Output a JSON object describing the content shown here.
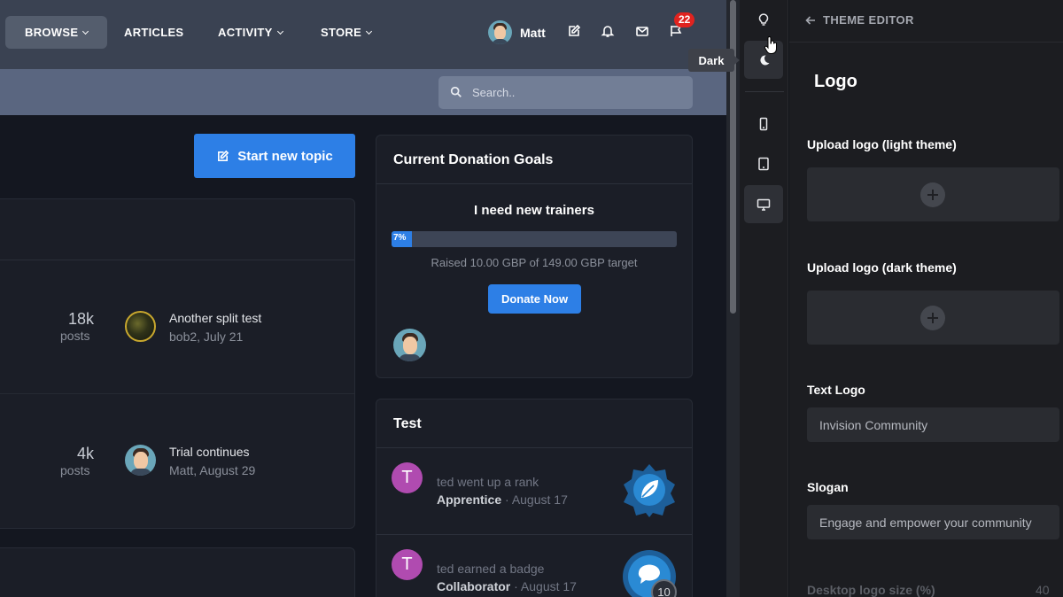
{
  "nav": {
    "items": [
      {
        "label": "BROWSE",
        "dropdown": true
      },
      {
        "label": "ARTICLES",
        "dropdown": false
      },
      {
        "label": "ACTIVITY",
        "dropdown": true
      },
      {
        "label": "STORE",
        "dropdown": true
      }
    ],
    "user_name": "Matt",
    "notification_count": "22",
    "icons": [
      "edit-icon",
      "bell-icon",
      "mail-icon",
      "flag-icon"
    ]
  },
  "search": {
    "placeholder": "Search.."
  },
  "main": {
    "start_topic_label": "Start new topic",
    "forums": [
      {
        "count": "18k",
        "count_label": "posts",
        "last_title": "Another split test",
        "last_meta": "bob2, July 21"
      },
      {
        "count": "4k",
        "count_label": "posts",
        "last_title": "Trial continues",
        "last_meta": "Matt, August 29"
      }
    ]
  },
  "donation": {
    "title": "Current Donation Goals",
    "goal_name": "I need new trainers",
    "progress_text": "7%",
    "progress_fraction": 0.07,
    "raised_text": "Raised 10.00 GBP of 149.00 GBP target",
    "button_label": "Donate Now"
  },
  "test_widget": {
    "title": "Test",
    "items": [
      {
        "initial": "T",
        "action": "ted went up a rank",
        "target": "Apprentice",
        "separator": "·",
        "date": "August 17"
      },
      {
        "initial": "T",
        "action": "ted earned a badge",
        "target": "Collaborator",
        "separator": "·",
        "date": "August 17"
      }
    ],
    "badge_count": "10"
  },
  "rail": {
    "tooltip": "Dark",
    "buttons": [
      "lightbulb-icon",
      "moon-icon",
      "phone-icon",
      "tablet-icon",
      "desktop-icon"
    ]
  },
  "editor": {
    "back_label": "THEME EDITOR",
    "section_title": "Logo",
    "upload_light_label": "Upload logo (light theme)",
    "upload_dark_label": "Upload logo (dark theme)",
    "text_logo_label": "Text Logo",
    "text_logo_value": "Invision Community",
    "slogan_label": "Slogan",
    "slogan_value": "Engage and empower your community",
    "desktop_size_label": "Desktop logo size (%)",
    "desktop_size_value": "40"
  },
  "colors": {
    "accent": "#2d7fe6",
    "nav_bg": "#3a4252",
    "badge_red": "#e0231f",
    "avatar_purple": "#b04bb0"
  }
}
